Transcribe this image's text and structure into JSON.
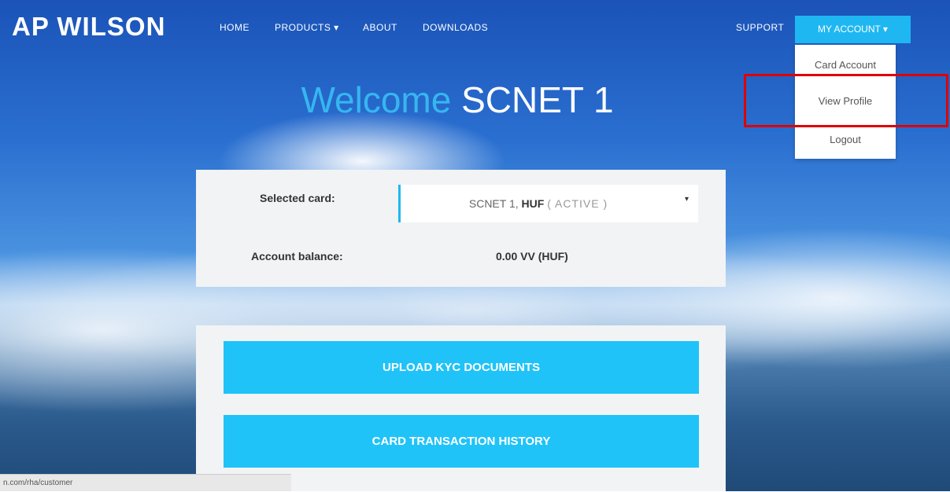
{
  "header": {
    "logo": "AP WILSON",
    "nav": {
      "home": "HOME",
      "products": "PRODUCTS ▾",
      "about": "ABOUT",
      "downloads": "DOWNLOADS",
      "support": "SUPPORT",
      "my_account": "MY ACCOUNT ▾"
    }
  },
  "account_menu": {
    "items": [
      "Card Account",
      "View Profile",
      "Logout"
    ],
    "highlighted": "View Profile",
    "highlight_color": "#e00000"
  },
  "welcome": {
    "prefix": "Welcome",
    "name": "SCNET 1"
  },
  "card_panel": {
    "selected_label": "Selected card:",
    "selected_value": {
      "name": "SCNET 1,",
      "currency": "HUF",
      "status": "( ACTIVE )"
    },
    "balance_label": "Account balance:",
    "balance_value": "0.00 VV (HUF)"
  },
  "actions": {
    "upload_kyc": "UPLOAD KYC DOCUMENTS",
    "transaction_history": "CARD TRANSACTION HISTORY"
  },
  "status_bar": {
    "url": "n.com/rha/customer"
  },
  "colors": {
    "accent": "#1fb7f2",
    "button": "#1fc3f8",
    "panel": "#f1f3f5"
  }
}
